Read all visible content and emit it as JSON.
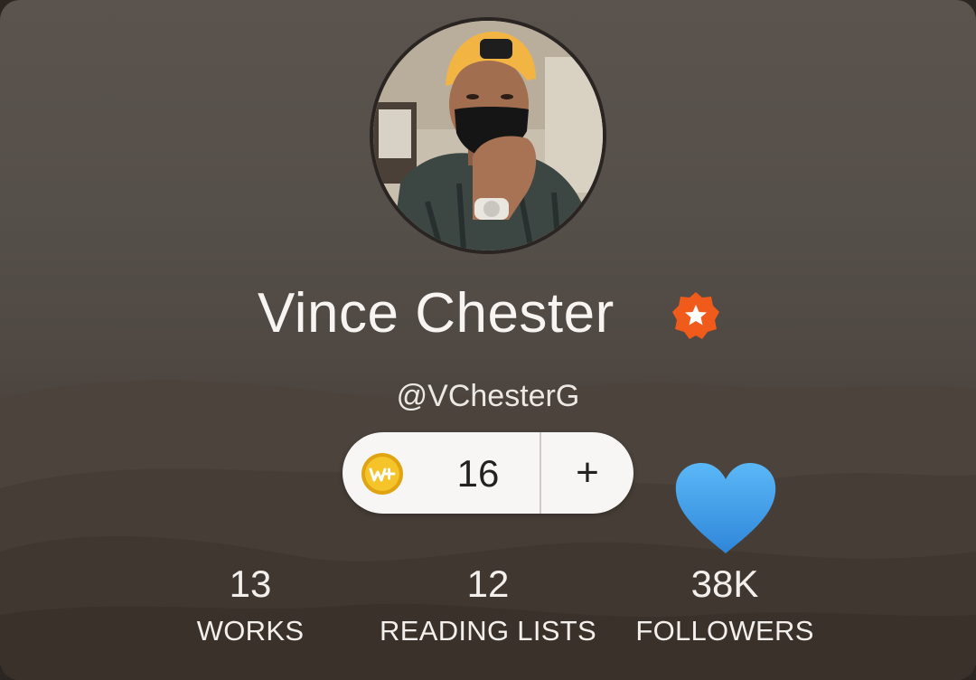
{
  "profile": {
    "display_name": "Vince Chester",
    "handle": "@VChesterG",
    "verified_badge_icon": "star-badge-icon",
    "avatar_description": "profile-photo"
  },
  "coins": {
    "count": "16",
    "add_label": "+",
    "icon": "wattpad-coin-icon"
  },
  "heart_icon": "blue-heart-icon",
  "stats": [
    {
      "value": "13",
      "label": "WORKS"
    },
    {
      "value": "12",
      "label": "READING LISTS"
    },
    {
      "value": "38K",
      "label": "FOLLOWERS"
    }
  ],
  "colors": {
    "badge": "#f05a1a",
    "coin": "#f2b91c",
    "heart": "#4aa8f0",
    "pill_background": "#f7f6f5"
  }
}
